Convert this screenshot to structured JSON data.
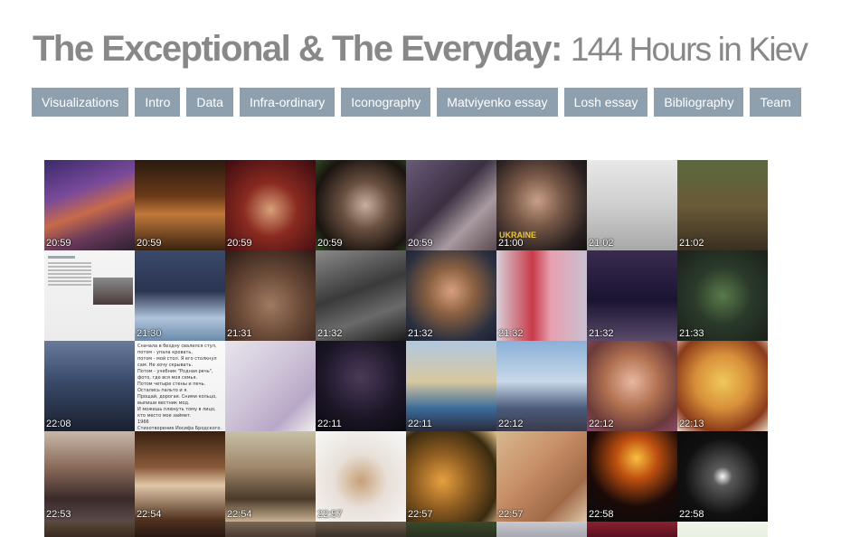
{
  "header": {
    "title": "The Exceptional & The Everyday:",
    "subtitle": "144 Hours in Kiev"
  },
  "nav": [
    {
      "label": "Visualizations"
    },
    {
      "label": "Intro"
    },
    {
      "label": "Data"
    },
    {
      "label": "Infra-ordinary"
    },
    {
      "label": "Iconography"
    },
    {
      "label": "Matviyenko essay"
    },
    {
      "label": "Losh essay"
    },
    {
      "label": "Bibliography"
    },
    {
      "label": "Team"
    }
  ],
  "grid": [
    {
      "time": "20:59",
      "bg": "linear-gradient(160deg,#3a2a6a 0%,#7a4a9a 35%,#c86a4a 55%,#6a3a5a 75%,#2a2030 100%)"
    },
    {
      "time": "20:59",
      "bg": "linear-gradient(180deg,#2a1a10 0%,#6a3a18 40%,#c0783a 60%,#3a2210 100%)"
    },
    {
      "time": "20:59",
      "bg": "radial-gradient(circle at 50% 55%,#d8a07a 0%,#8a2a20 40%,#3a0a10 100%)"
    },
    {
      "time": "20:59",
      "bg": "radial-gradient(circle at 55% 50%,#c8b0a0 0%,#6a5040 35%,#1a1410 75%,#2a4a20 100%)"
    },
    {
      "time": "20:59",
      "bg": "linear-gradient(135deg,#6a5a7a 0%,#3a3040 45%,#a89aa0 70%,#5a4a50 100%)"
    },
    {
      "time": "21:00",
      "bg": "radial-gradient(ellipse at 45% 45%,#c8a088 0%,#7a5a48 35%,#2a2020 75%,#101010 100%)",
      "badge": "UKRAINE"
    },
    {
      "time": "21:02",
      "bg": "linear-gradient(180deg,#e8e8e8 0%,#cfcfcf 50%,#a8a8a8 100%)"
    },
    {
      "time": "21:02",
      "bg": "linear-gradient(180deg,#5a6a3a 0%,#6a5a38 50%,#3a3020 100%)"
    },
    {
      "time": "",
      "bg": "linear-gradient(180deg,#f4f4f4 0%,#ececec 100%)",
      "doc": true
    },
    {
      "time": "21:30",
      "bg": "linear-gradient(180deg,#3a4a6a 0%,#2a3450 45%,#b0c4dc 75%,#6a8aaa 100%)"
    },
    {
      "time": "21:31",
      "bg": "radial-gradient(circle at 50% 60%,#a07a60 0%,#6a4a38 45%,#2a1a14 100%)"
    },
    {
      "time": "21:32",
      "bg": "linear-gradient(160deg,#8a8a8a 0%,#3a3a3a 45%,#6a6a6a 70%,#1a1a1a 100%)"
    },
    {
      "time": "21:32",
      "bg": "radial-gradient(circle at 50% 45%,#d8a080 0%,#8a6040 35%,#2a3040 75%,#1a2030 100%)"
    },
    {
      "time": "21:32",
      "bg": "linear-gradient(90deg,#d8d0d8 0%,#c83a4a 40%,#e8a0b0 60%,#c8c0d0 100%)"
    },
    {
      "time": "21:32",
      "bg": "linear-gradient(180deg,#3a2a50 0%,#1a1430 55%,#5a4a6a 100%)"
    },
    {
      "time": "21:33",
      "bg": "radial-gradient(circle at 50% 50%,#5a7a4a 0%,#2a3a2a 45%,#1a2018 100%)"
    },
    {
      "time": "22:08",
      "bg": "linear-gradient(180deg,#6a7a9a 0%,#3a4a6a 45%,#1a2030 100%)"
    },
    {
      "time": "",
      "bg": "linear-gradient(180deg,#fafafa 0%,#f0f0f0 100%)",
      "poem": true
    },
    {
      "time": "",
      "bg": "linear-gradient(135deg,#e8e4ec 0%,#cfc4d8 45%,#b8a8c8 75%,#f0f0f0 100%)"
    },
    {
      "time": "22:11",
      "bg": "radial-gradient(circle at 50% 40%,#4a3a5a 0%,#1a1424 60%,#0a0a10 100%)"
    },
    {
      "time": "22:11",
      "bg": "linear-gradient(180deg,#b0c8e0 0%,#d8c8a0 45%,#3a6a9a 75%,#2a2a3a 100%)"
    },
    {
      "time": "22:12",
      "bg": "linear-gradient(180deg,#8ab0d8 0%,#c8d8e8 45%,#4a5a7a 75%,#3a3a4a 100%)"
    },
    {
      "time": "22:12",
      "bg": "radial-gradient(circle at 50% 45%,#e8b8a0 0%,#b07050 40%,#6a3a3a 75%,#8a4a6a 100%)"
    },
    {
      "time": "22:13",
      "bg": "radial-gradient(circle at 50% 45%,#f0c85a 0%,#d8903a 40%,#8a3a1a 75%,#e8d8c8 100%)"
    },
    {
      "time": "22:53",
      "bg": "linear-gradient(180deg,#c8b8a8 0%,#8a6a5a 40%,#3a2a2a 75%,#5a4a4a 100%)"
    },
    {
      "time": "22:54",
      "bg": "linear-gradient(180deg,#3a2010 0%,#8a5a3a 40%,#e0c8a8 60%,#4a2a18 100%)"
    },
    {
      "time": "22:54",
      "bg": "linear-gradient(180deg,#c8c0a8 0%,#a0886a 40%,#4a3a2a 75%,#c8b090 100%)"
    },
    {
      "time": "22:57",
      "bg": "radial-gradient(circle at 50% 55%,#c8a078 0%,#e8e0d8 40%,#f8f8f8 100%)"
    },
    {
      "time": "22:57",
      "bg": "radial-gradient(circle at 40% 55%,#e8a040 0%,#8a5a20 40%,#3a2a10 75%,#e8c890 100%)"
    },
    {
      "time": "22:57",
      "bg": "linear-gradient(135deg,#d8b890 0%,#c89068 40%,#a06a48 75%,#e0c8a8 100%)"
    },
    {
      "time": "22:58",
      "bg": "radial-gradient(circle at 55% 30%,#f8c040 0%,#c05010 25%,#1a0a08 60%,#0a0a0a 100%)"
    },
    {
      "time": "22:58",
      "bg": "radial-gradient(circle at 50% 50%,#f8f8f8 0%,#5a5a5a 15%,#101010 60%,#0a0a0a 100%)"
    }
  ],
  "partial_row": [
    {
      "bg": "linear-gradient(180deg,#5a4a3a 0%,#3a2a20 100%)"
    },
    {
      "bg": "linear-gradient(180deg,#4a3020 0%,#2a1810 100%)"
    },
    {
      "bg": "linear-gradient(180deg,#7a6a5a 0%,#4a3a30 100%)"
    },
    {
      "bg": "linear-gradient(180deg,#6a5a4a 0%,#3a3028 100%)"
    },
    {
      "bg": "linear-gradient(180deg,#3a4a2a 0%,#2a3020 100%)"
    },
    {
      "bg": "linear-gradient(180deg,#c8c8d0 0%,#a8a8b0 100%)"
    },
    {
      "bg": "linear-gradient(180deg,#8a2030 0%,#5a1020 100%)"
    },
    {
      "bg": "linear-gradient(180deg,#f0f6ea 0%,#e8f0e0 100%)"
    }
  ],
  "poem_text": "Сначала в бездну свалился стул,\nпотом - упала кровать,\nпотом - мой стол. Я его столкнул\nсам. Не хочу скрывать.\nПотом - учебник \"Родная речь\",\nфото, где вся моя семья.\nПотом четыре стены и печь.\nОстались пальто и я.\nПрощай, дорогая. Сними кольцо,\nвыпиши вестник мод.\nИ можешь плюнуть тому в лицо,\nкто место мое займет.\n1966\nСтихотворение Иосифа Бродского."
}
